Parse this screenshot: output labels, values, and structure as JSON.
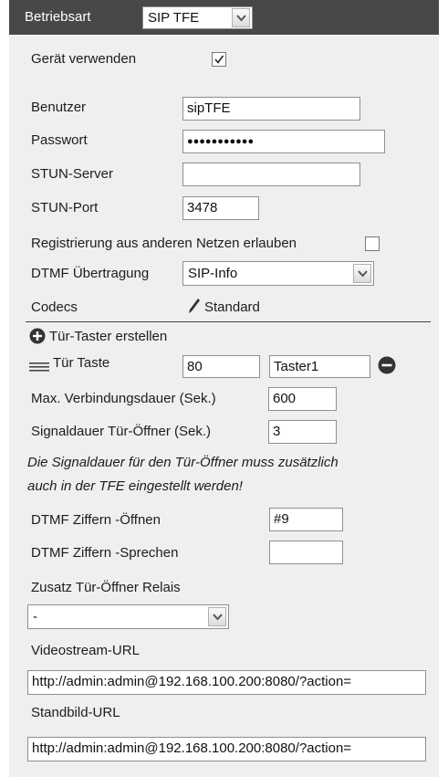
{
  "header": {
    "betriebsart_label": "Betriebsart",
    "betriebsart_value": "SIP TFE"
  },
  "geraet_verwenden": {
    "label": "Gerät verwenden",
    "checked": true
  },
  "benutzer": {
    "label": "Benutzer",
    "value": "sipTFE"
  },
  "passwort": {
    "label": "Passwort",
    "masked": "●●●●●●●●●●●"
  },
  "stun_server": {
    "label": "STUN-Server",
    "value": ""
  },
  "stun_port": {
    "label": "STUN-Port",
    "value": "3478"
  },
  "registrierung": {
    "label": "Registrierung aus anderen Netzen erlauben",
    "checked": false
  },
  "dtmf_uebertragung": {
    "label": "DTMF Übertragung",
    "value": "SIP-Info"
  },
  "codecs": {
    "label": "Codecs",
    "value": "Standard"
  },
  "tuer_taster_erstellen": {
    "label": "Tür-Taster erstellen"
  },
  "tuer_taste": {
    "label": "Tür Taste",
    "number": "80",
    "name": "Taster1"
  },
  "max_verbindungsdauer": {
    "label": "Max. Verbindungsdauer (Sek.)",
    "value": "600"
  },
  "signaldauer": {
    "label": "Signaldauer Tür-Öffner (Sek.)",
    "value": "3"
  },
  "hinweis": {
    "line1": "Die Signaldauer für den Tür-Öffner muss zusätzlich",
    "line2": "auch in der TFE eingestellt werden!"
  },
  "dtmf_oeffnen": {
    "label": "DTMF Ziffern -Öffnen",
    "value": "#9"
  },
  "dtmf_sprechen": {
    "label": "DTMF Ziffern -Sprechen",
    "value": ""
  },
  "zusatz_relais": {
    "label": "Zusatz Tür-Öffner Relais",
    "value": "-"
  },
  "videostream": {
    "label": "Videostream-URL",
    "value": "http://admin:admin@192.168.100.200:8080/?action="
  },
  "standbild": {
    "label": "Standbild-URL",
    "value": "http://admin:admin@192.168.100.200:8080/?action="
  },
  "colors": {
    "header_bg": "#484848",
    "panel_bg": "#efefef"
  }
}
